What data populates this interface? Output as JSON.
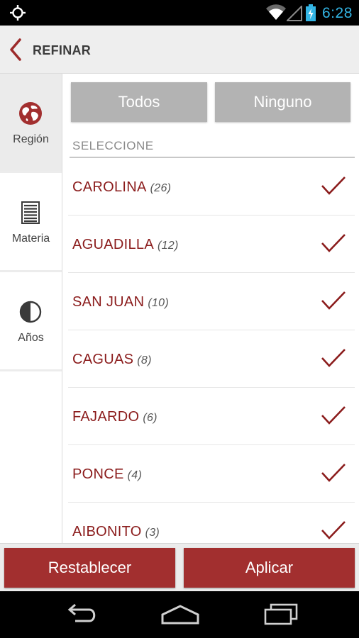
{
  "status_bar": {
    "time": "6:28",
    "icons": [
      "gps-icon",
      "wifi-icon",
      "signal-icon",
      "battery-charging-icon"
    ],
    "accent_color": "#33b5e5"
  },
  "action_bar": {
    "back_icon": "chevron-left-icon",
    "title": "REFINAR"
  },
  "sidebar": {
    "items": [
      {
        "label": "Región",
        "icon": "globe-icon",
        "active": true
      },
      {
        "label": "Materia",
        "icon": "document-lines-icon",
        "active": false
      },
      {
        "label": "Años",
        "icon": "pie-clock-icon",
        "active": false
      }
    ]
  },
  "content": {
    "select_all_label": "Todos",
    "select_none_label": "Ninguno",
    "section_label": "SELECCIONE",
    "regions": [
      {
        "name": "CAROLINA",
        "count": "(26)",
        "checked": true
      },
      {
        "name": "AGUADILLA",
        "count": "(12)",
        "checked": true
      },
      {
        "name": "SAN JUAN",
        "count": "(10)",
        "checked": true
      },
      {
        "name": "CAGUAS",
        "count": "(8)",
        "checked": true
      },
      {
        "name": "FAJARDO",
        "count": "(6)",
        "checked": true
      },
      {
        "name": "PONCE",
        "count": "(4)",
        "checked": true
      },
      {
        "name": "AIBONITO",
        "count": "(3)",
        "checked": true
      }
    ]
  },
  "footer": {
    "reset_label": "Restablecer",
    "apply_label": "Aplicar"
  },
  "nav_bar": {
    "icons": [
      "back-nav-icon",
      "home-nav-icon",
      "recent-apps-icon"
    ]
  },
  "colors": {
    "brand_red": "#8b1c1c",
    "button_red": "#a22f2f",
    "button_grey": "#b3b3b3"
  }
}
